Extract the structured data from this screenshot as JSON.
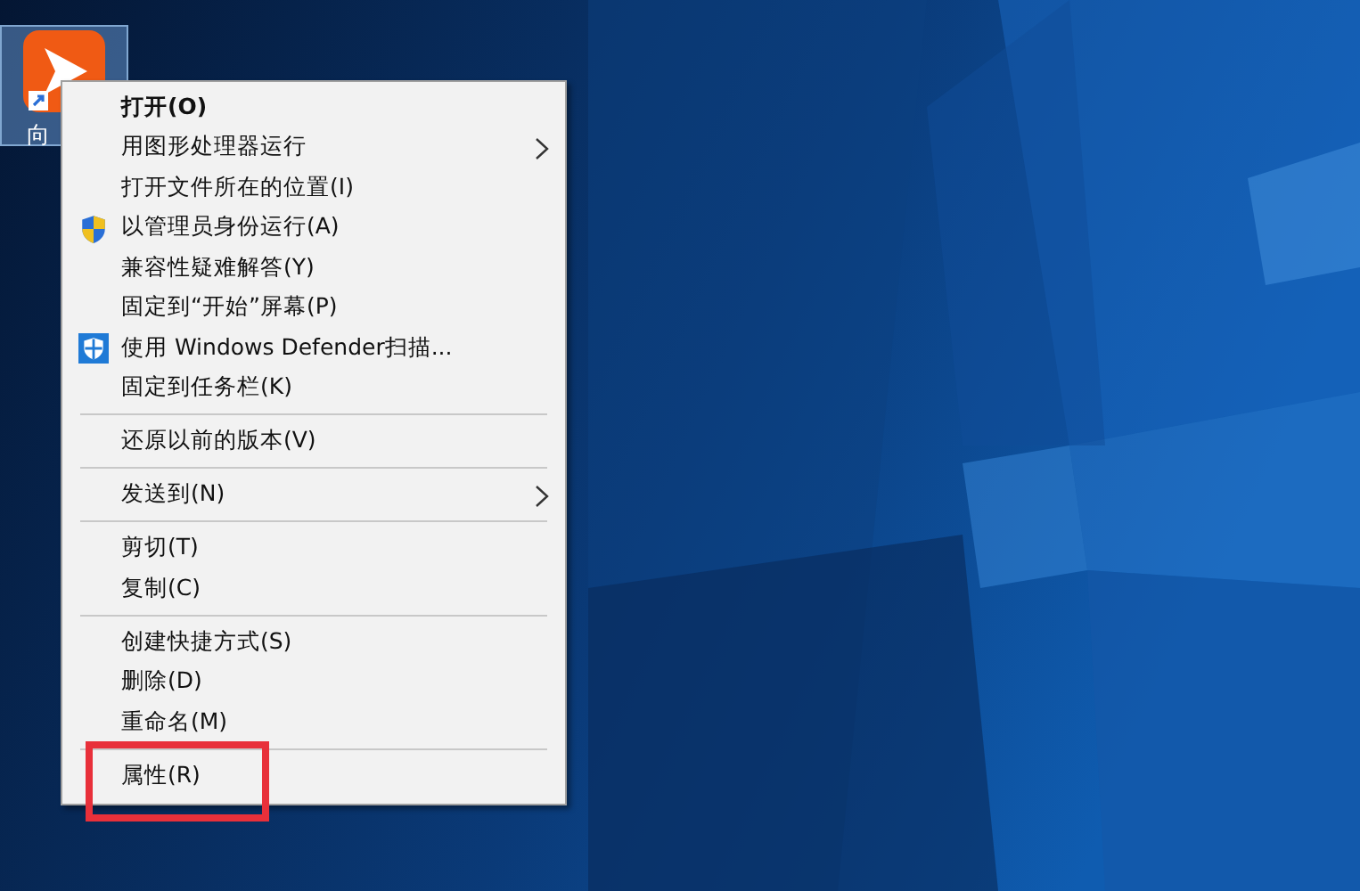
{
  "desktop": {
    "icons": [
      {
        "label": "向",
        "selected": true
      }
    ]
  },
  "context_menu": {
    "groups": [
      [
        {
          "label": "打开(O)",
          "kind": "plain",
          "default": true,
          "submenu": false,
          "annotated": false
        },
        {
          "label": "用图形处理器运行",
          "kind": "plain",
          "default": false,
          "submenu": true,
          "annotated": false
        },
        {
          "label": "打开文件所在的位置(I)",
          "kind": "plain",
          "default": false,
          "submenu": false,
          "annotated": false
        },
        {
          "label": "以管理员身份运行(A)",
          "kind": "shield",
          "default": false,
          "submenu": false,
          "annotated": false
        },
        {
          "label": "兼容性疑难解答(Y)",
          "kind": "plain",
          "default": false,
          "submenu": false,
          "annotated": false
        },
        {
          "label": "固定到“开始”屏幕(P)",
          "kind": "plain",
          "default": false,
          "submenu": false,
          "annotated": false
        },
        {
          "label": "使用 Windows Defender扫描...",
          "kind": "defender",
          "default": false,
          "submenu": false,
          "annotated": false
        },
        {
          "label": "固定到任务栏(K)",
          "kind": "plain",
          "default": false,
          "submenu": false,
          "annotated": false
        }
      ],
      [
        {
          "label": "还原以前的版本(V)",
          "kind": "plain",
          "default": false,
          "submenu": false,
          "annotated": false
        }
      ],
      [
        {
          "label": "发送到(N)",
          "kind": "plain",
          "default": false,
          "submenu": true,
          "annotated": false
        }
      ],
      [
        {
          "label": "剪切(T)",
          "kind": "plain",
          "default": false,
          "submenu": false,
          "annotated": false
        },
        {
          "label": "复制(C)",
          "kind": "plain",
          "default": false,
          "submenu": false,
          "annotated": false
        }
      ],
      [
        {
          "label": "创建快捷方式(S)",
          "kind": "plain",
          "default": false,
          "submenu": false,
          "annotated": false
        },
        {
          "label": "删除(D)",
          "kind": "plain",
          "default": false,
          "submenu": false,
          "annotated": false
        },
        {
          "label": "重命名(M)",
          "kind": "plain",
          "default": false,
          "submenu": false,
          "annotated": false
        }
      ],
      [
        {
          "label": "属性(R)",
          "kind": "plain",
          "default": false,
          "submenu": false,
          "annotated": true
        }
      ]
    ]
  }
}
